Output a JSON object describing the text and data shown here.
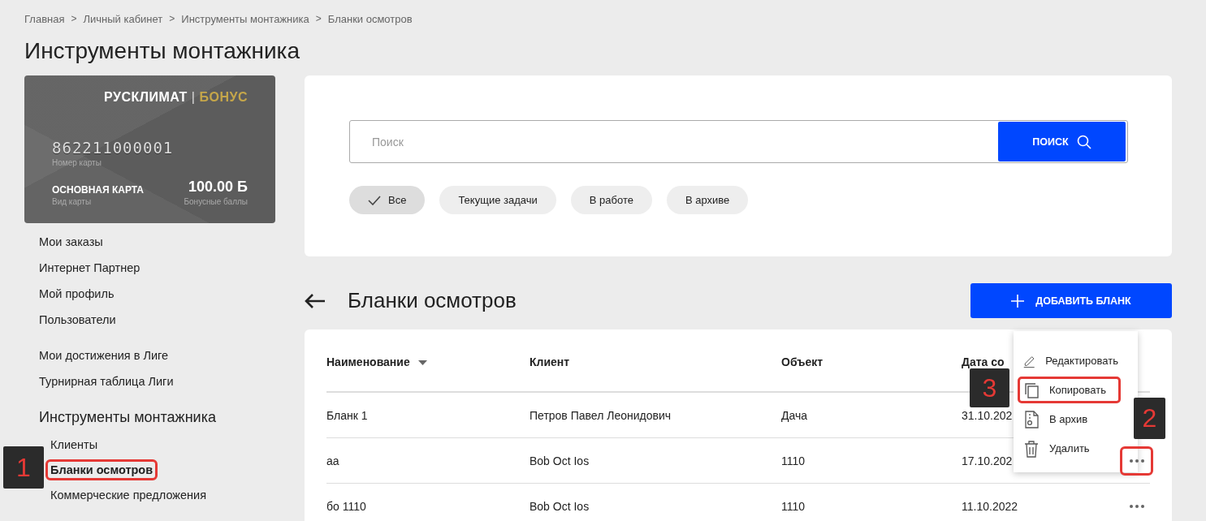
{
  "breadcrumbs": [
    "Главная",
    "Личный кабинет",
    "Инструменты монтажника",
    "Бланки осмотров"
  ],
  "breadcrumb_separator": ">",
  "page_title": "Инструменты монтажника",
  "bonus_card": {
    "brand": "РУСКЛИМАТ",
    "brand_divider": "|",
    "brand_suffix": "БОНУС",
    "number": "862211000001",
    "number_label": "Номер карты",
    "type": "ОСНОВНАЯ КАРТА",
    "type_label": "Вид карты",
    "balance": "100.00 Б",
    "balance_label": "Бонусные баллы"
  },
  "sidebar": {
    "groups": [
      {
        "items": [
          {
            "label": "Мои заказы",
            "selected": false,
            "outlined": false
          },
          {
            "label": "Интернет Партнер",
            "selected": false,
            "outlined": false
          },
          {
            "label": "Мой профиль",
            "selected": false,
            "outlined": false
          },
          {
            "label": "Пользователи",
            "selected": false,
            "outlined": false
          }
        ]
      },
      {
        "items": [
          {
            "label": "Мои достижения в Лиге",
            "selected": false,
            "outlined": false
          },
          {
            "label": "Турнирная таблица Лиги",
            "selected": false,
            "outlined": false
          }
        ]
      },
      {
        "heading": "Инструменты монтажника",
        "children": [
          {
            "label": "Клиенты",
            "selected": false,
            "outlined": false
          },
          {
            "label": "Бланки осмотров",
            "selected": true,
            "outlined": true
          },
          {
            "label": "Коммерческие предложения",
            "selected": false,
            "outlined": false
          }
        ]
      }
    ]
  },
  "search": {
    "placeholder": "Поиск",
    "button": "ПОИСК"
  },
  "filters": [
    {
      "label": "Все",
      "selected": true
    },
    {
      "label": "Текущие задачи",
      "selected": false
    },
    {
      "label": "В работе",
      "selected": false
    },
    {
      "label": "В архиве",
      "selected": false
    }
  ],
  "section_title": "Бланки осмотров",
  "add_button": "ДОБАВИТЬ БЛАНК",
  "table": {
    "columns": [
      {
        "label": "Наименование",
        "sorted": true
      },
      {
        "label": "Клиент",
        "sorted": false
      },
      {
        "label": "Объект",
        "sorted": false
      },
      {
        "label": "Дата со",
        "sorted": false
      }
    ],
    "rows": [
      {
        "cells": [
          "Бланк 1",
          "Петров Павел Леонидович",
          "Дача",
          "31.10.202"
        ]
      },
      {
        "cells": [
          "аа",
          "Bob Oct Ios",
          "1110",
          "17.10.202"
        ],
        "menu_button": {
          "outlined": true
        }
      },
      {
        "cells": [
          "бо 1110",
          "Bob Oct Ios",
          "1110",
          "11.10.2022"
        ],
        "menu_button": {
          "outlined": false
        }
      }
    ]
  },
  "context_menu": [
    {
      "kind": "edit",
      "label": "Редактировать",
      "outlined": false
    },
    {
      "kind": "copy",
      "label": "Копировать",
      "outlined": true
    },
    {
      "kind": "archive",
      "label": "В архив",
      "outlined": false
    },
    {
      "kind": "delete",
      "label": "Удалить",
      "outlined": false
    }
  ],
  "annotations": [
    {
      "number": "1"
    },
    {
      "number": "2"
    },
    {
      "number": "3"
    }
  ]
}
